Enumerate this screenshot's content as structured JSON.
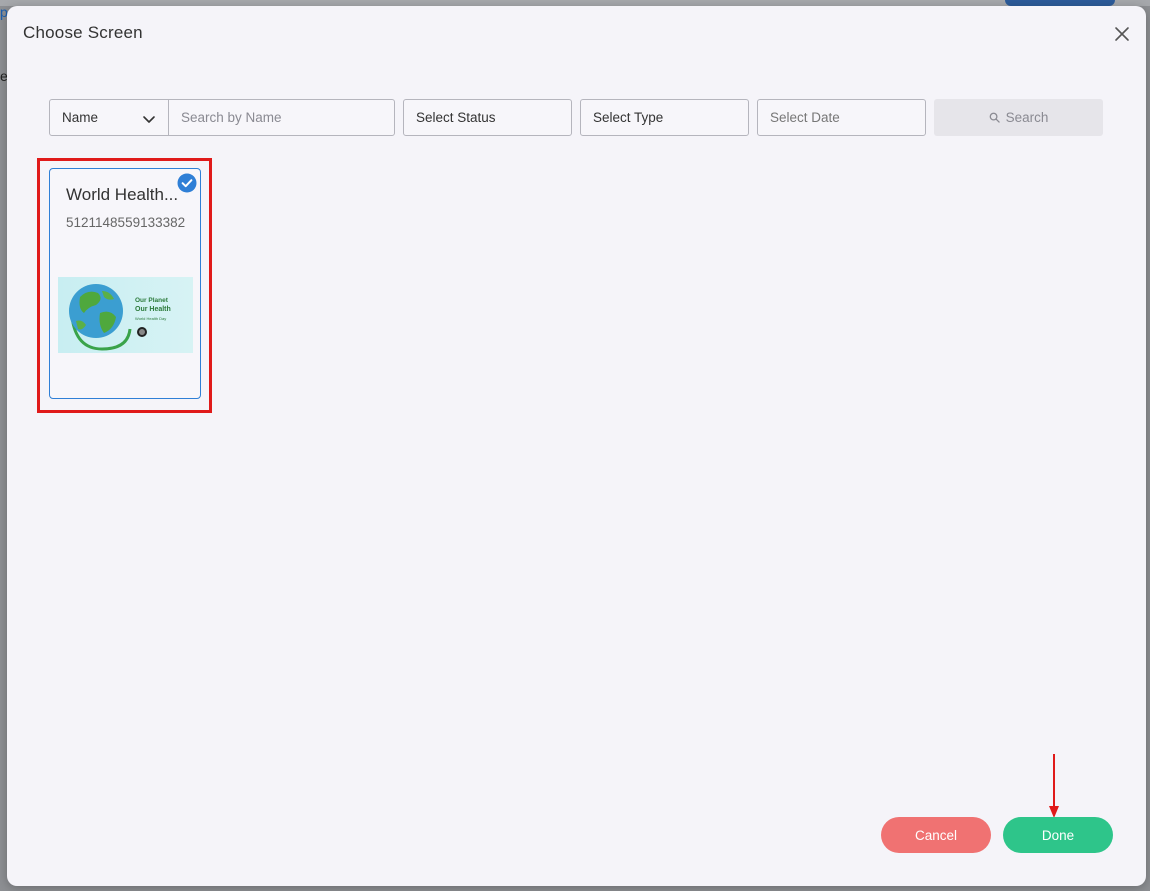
{
  "background": {
    "link_fragment": "p",
    "letter_fragment": "e"
  },
  "modal": {
    "title": "Choose Screen",
    "close_icon": "close-icon"
  },
  "filters": {
    "name_select_value": "Name",
    "search_placeholder": "Search by Name",
    "status_label": "Select Status",
    "type_label": "Select Type",
    "date_label": "Select Date",
    "search_button_label": "Search"
  },
  "cards": [
    {
      "title": "World Health...",
      "id": "5121148559133382",
      "selected": true,
      "thumbnail": {
        "line1": "Our Planet",
        "line2": "Our Health",
        "line3": "World Health Day"
      }
    }
  ],
  "footer": {
    "cancel_label": "Cancel",
    "done_label": "Done"
  },
  "colors": {
    "accent_blue": "#2f7fd6",
    "cancel": "#f07272",
    "done": "#2ec58a",
    "highlight": "#e01a1a"
  }
}
